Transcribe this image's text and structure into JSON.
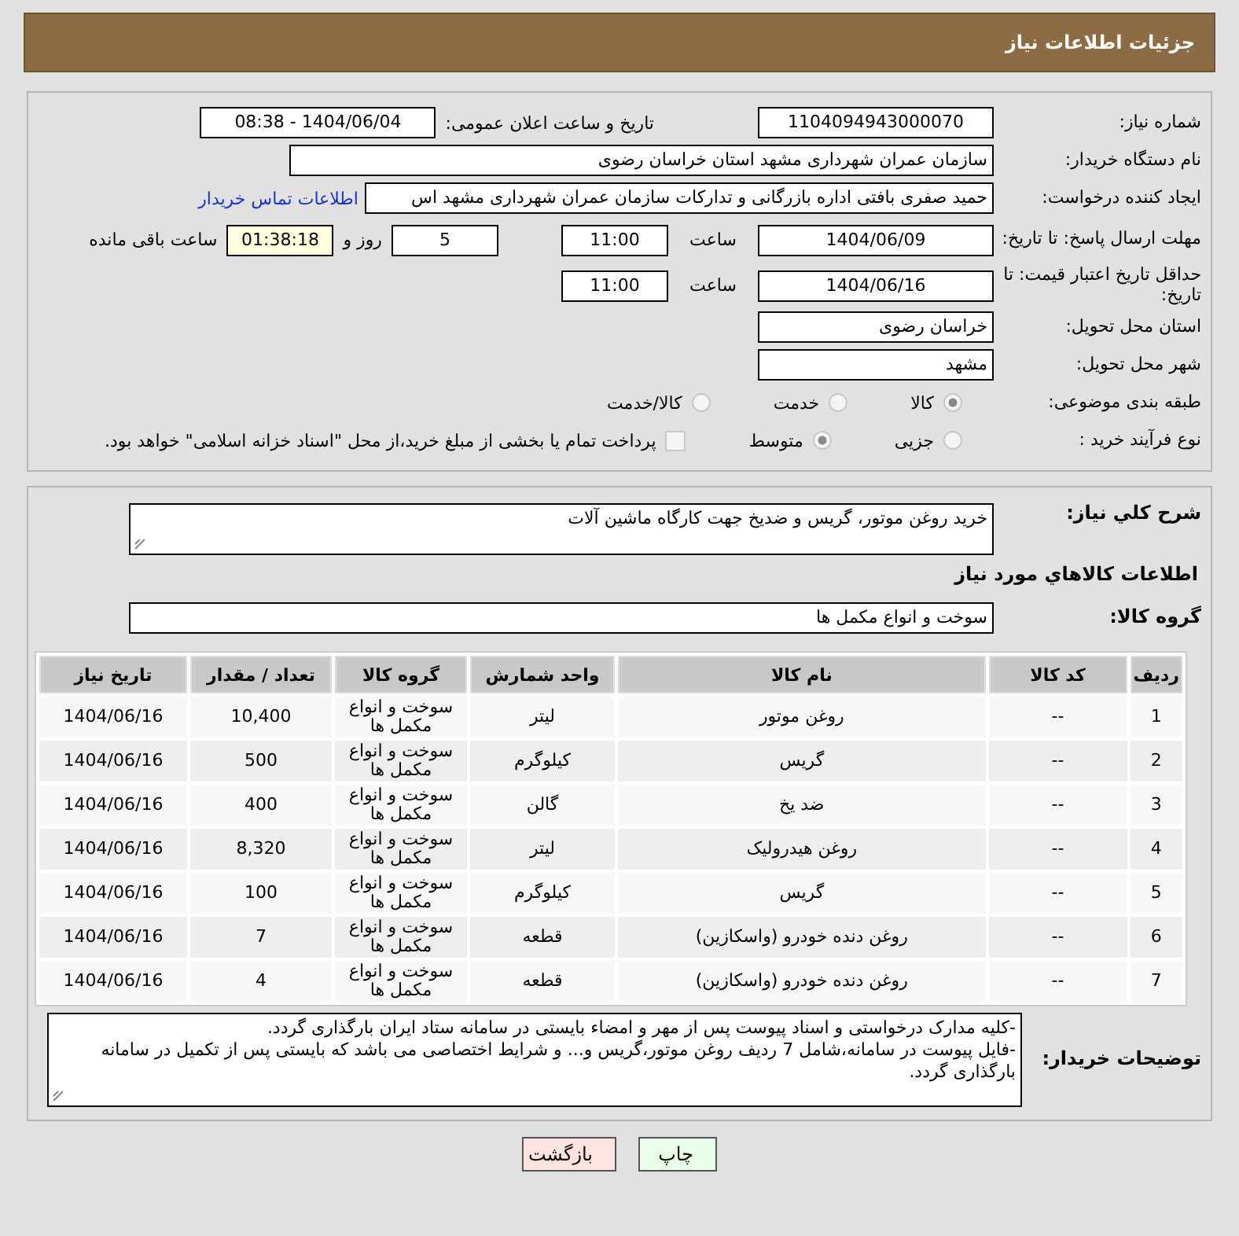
{
  "header": {
    "title": "جزئیات اطلاعات نیاز"
  },
  "need_number": {
    "label": "شماره نیاز:",
    "value": "1104094943000070"
  },
  "announce": {
    "label": "تاریخ و ساعت اعلان عمومی:",
    "value": "1404/06/04 - 08:38"
  },
  "buyer_org": {
    "label": "نام دستگاه خریدار:",
    "value": "سازمان عمران شهرداری مشهد استان خراسان رضوی"
  },
  "requester": {
    "label": "ایجاد کننده درخواست:",
    "value": "حمید صفری بافتی اداره بازرگانی و تدارکات  سازمان عمران شهرداری مشهد اس",
    "link": "اطلاعات تماس خریدار"
  },
  "reply_deadline": {
    "label": "مهلت ارسال پاسخ: تا تاریخ:",
    "date": "1404/06/09",
    "time_label": "ساعت",
    "time": "11:00",
    "days": "5",
    "days_label": "روز و",
    "remaining": "01:38:18",
    "remaining_label": "ساعت باقی مانده"
  },
  "price_validity": {
    "label": "حداقل تاریخ اعتبار قیمت: تا تاریخ:",
    "date": "1404/06/16",
    "time_label": "ساعت",
    "time": "11:00"
  },
  "province": {
    "label": "استان محل تحویل:",
    "value": "خراسان رضوی"
  },
  "city": {
    "label": "شهر محل تحویل:",
    "value": "مشهد"
  },
  "category": {
    "label": "طبقه بندی موضوعی:",
    "options": [
      {
        "label": "کالا",
        "selected": true
      },
      {
        "label": "خدمت",
        "selected": false
      },
      {
        "label": "کالا/خدمت",
        "selected": false
      }
    ]
  },
  "process": {
    "label": "نوع فرآیند خرید :",
    "options": [
      {
        "label": "جزیی",
        "selected": false
      },
      {
        "label": "متوسط",
        "selected": true
      }
    ],
    "payment": {
      "checked": false,
      "label": "پرداخت تمام یا بخشی از مبلغ خرید،از محل \"اسناد خزانه اسلامی\" خواهد بود."
    }
  },
  "description": {
    "label": "شرح کلي نياز:",
    "value": "خرید روغن موتور، گریس و ضدیخ جهت کارگاه ماشین آلات"
  },
  "goods_title": "اطلاعات کالاهاي مورد نياز",
  "goods_group": {
    "label": "گروه کالا:",
    "value": "سوخت و انواع مکمل ها"
  },
  "table": {
    "columns": [
      "ردیف",
      "کد کالا",
      "نام کالا",
      "واحد شمارش",
      "گروه کالا",
      "تعداد / مقدار",
      "تاریخ نیاز"
    ],
    "rows": [
      [
        "1",
        "--",
        "روغن موتور",
        "لیتر",
        "سوخت و انواع مکمل ها",
        "10,400",
        "1404/06/16"
      ],
      [
        "2",
        "--",
        "گریس",
        "کیلوگرم",
        "سوخت و انواع مکمل ها",
        "500",
        "1404/06/16"
      ],
      [
        "3",
        "--",
        "ضد یخ",
        "گالن",
        "سوخت و انواع مکمل ها",
        "400",
        "1404/06/16"
      ],
      [
        "4",
        "--",
        "روغن هیدرولیک",
        "لیتر",
        "سوخت و انواع مکمل ها",
        "8,320",
        "1404/06/16"
      ],
      [
        "5",
        "--",
        "گریس",
        "کیلوگرم",
        "سوخت و انواع مکمل ها",
        "100",
        "1404/06/16"
      ],
      [
        "6",
        "--",
        "روغن دنده خودرو (واسکازین)",
        "قطعه",
        "سوخت و انواع مکمل ها",
        "7",
        "1404/06/16"
      ],
      [
        "7",
        "--",
        "روغن دنده خودرو (واسکازین)",
        "قطعه",
        "سوخت و انواع مکمل ها",
        "4",
        "1404/06/16"
      ]
    ]
  },
  "buyer_notes": {
    "label": "توضیحات خریدار:",
    "paragraphs": [
      "-کلیه مدارک درخواستی و اسناد پیوست پس از مهر و امضاء بایستی در سامانه ستاد ایران بارگذاری گردد.",
      "-فایل پیوست در سامانه،شامل 7 ردیف روغن موتور،گریس و... و شرایط اختصاصی می باشد که بایستی پس از تکمیل در سامانه بارگذاری گردد."
    ]
  },
  "buttons": [
    {
      "label": "چاپ",
      "kind": "print"
    },
    {
      "label": "بازگشت",
      "kind": "back"
    }
  ]
}
